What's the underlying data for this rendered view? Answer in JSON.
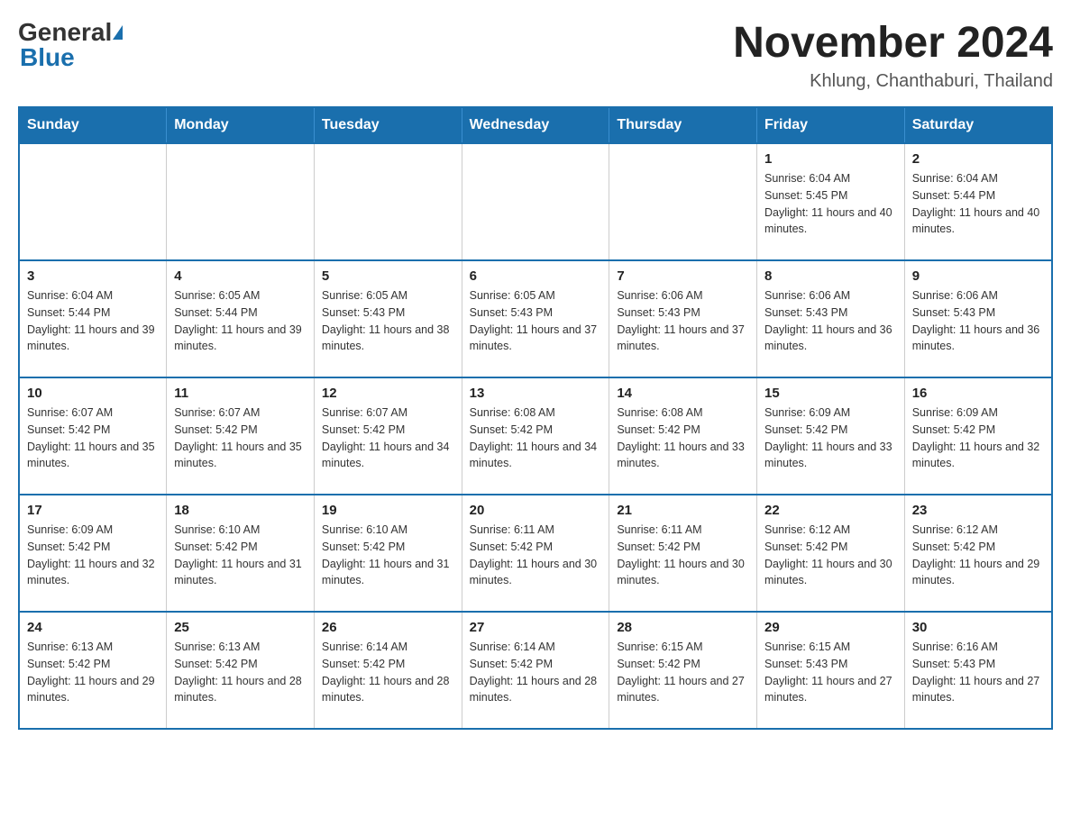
{
  "logo": {
    "general": "General",
    "blue": "Blue"
  },
  "title": "November 2024",
  "subtitle": "Khlung, Chanthaburi, Thailand",
  "weekdays": [
    "Sunday",
    "Monday",
    "Tuesday",
    "Wednesday",
    "Thursday",
    "Friday",
    "Saturday"
  ],
  "weeks": [
    [
      {
        "day": "",
        "info": ""
      },
      {
        "day": "",
        "info": ""
      },
      {
        "day": "",
        "info": ""
      },
      {
        "day": "",
        "info": ""
      },
      {
        "day": "",
        "info": ""
      },
      {
        "day": "1",
        "info": "Sunrise: 6:04 AM\nSunset: 5:45 PM\nDaylight: 11 hours and 40 minutes."
      },
      {
        "day": "2",
        "info": "Sunrise: 6:04 AM\nSunset: 5:44 PM\nDaylight: 11 hours and 40 minutes."
      }
    ],
    [
      {
        "day": "3",
        "info": "Sunrise: 6:04 AM\nSunset: 5:44 PM\nDaylight: 11 hours and 39 minutes."
      },
      {
        "day": "4",
        "info": "Sunrise: 6:05 AM\nSunset: 5:44 PM\nDaylight: 11 hours and 39 minutes."
      },
      {
        "day": "5",
        "info": "Sunrise: 6:05 AM\nSunset: 5:43 PM\nDaylight: 11 hours and 38 minutes."
      },
      {
        "day": "6",
        "info": "Sunrise: 6:05 AM\nSunset: 5:43 PM\nDaylight: 11 hours and 37 minutes."
      },
      {
        "day": "7",
        "info": "Sunrise: 6:06 AM\nSunset: 5:43 PM\nDaylight: 11 hours and 37 minutes."
      },
      {
        "day": "8",
        "info": "Sunrise: 6:06 AM\nSunset: 5:43 PM\nDaylight: 11 hours and 36 minutes."
      },
      {
        "day": "9",
        "info": "Sunrise: 6:06 AM\nSunset: 5:43 PM\nDaylight: 11 hours and 36 minutes."
      }
    ],
    [
      {
        "day": "10",
        "info": "Sunrise: 6:07 AM\nSunset: 5:42 PM\nDaylight: 11 hours and 35 minutes."
      },
      {
        "day": "11",
        "info": "Sunrise: 6:07 AM\nSunset: 5:42 PM\nDaylight: 11 hours and 35 minutes."
      },
      {
        "day": "12",
        "info": "Sunrise: 6:07 AM\nSunset: 5:42 PM\nDaylight: 11 hours and 34 minutes."
      },
      {
        "day": "13",
        "info": "Sunrise: 6:08 AM\nSunset: 5:42 PM\nDaylight: 11 hours and 34 minutes."
      },
      {
        "day": "14",
        "info": "Sunrise: 6:08 AM\nSunset: 5:42 PM\nDaylight: 11 hours and 33 minutes."
      },
      {
        "day": "15",
        "info": "Sunrise: 6:09 AM\nSunset: 5:42 PM\nDaylight: 11 hours and 33 minutes."
      },
      {
        "day": "16",
        "info": "Sunrise: 6:09 AM\nSunset: 5:42 PM\nDaylight: 11 hours and 32 minutes."
      }
    ],
    [
      {
        "day": "17",
        "info": "Sunrise: 6:09 AM\nSunset: 5:42 PM\nDaylight: 11 hours and 32 minutes."
      },
      {
        "day": "18",
        "info": "Sunrise: 6:10 AM\nSunset: 5:42 PM\nDaylight: 11 hours and 31 minutes."
      },
      {
        "day": "19",
        "info": "Sunrise: 6:10 AM\nSunset: 5:42 PM\nDaylight: 11 hours and 31 minutes."
      },
      {
        "day": "20",
        "info": "Sunrise: 6:11 AM\nSunset: 5:42 PM\nDaylight: 11 hours and 30 minutes."
      },
      {
        "day": "21",
        "info": "Sunrise: 6:11 AM\nSunset: 5:42 PM\nDaylight: 11 hours and 30 minutes."
      },
      {
        "day": "22",
        "info": "Sunrise: 6:12 AM\nSunset: 5:42 PM\nDaylight: 11 hours and 30 minutes."
      },
      {
        "day": "23",
        "info": "Sunrise: 6:12 AM\nSunset: 5:42 PM\nDaylight: 11 hours and 29 minutes."
      }
    ],
    [
      {
        "day": "24",
        "info": "Sunrise: 6:13 AM\nSunset: 5:42 PM\nDaylight: 11 hours and 29 minutes."
      },
      {
        "day": "25",
        "info": "Sunrise: 6:13 AM\nSunset: 5:42 PM\nDaylight: 11 hours and 28 minutes."
      },
      {
        "day": "26",
        "info": "Sunrise: 6:14 AM\nSunset: 5:42 PM\nDaylight: 11 hours and 28 minutes."
      },
      {
        "day": "27",
        "info": "Sunrise: 6:14 AM\nSunset: 5:42 PM\nDaylight: 11 hours and 28 minutes."
      },
      {
        "day": "28",
        "info": "Sunrise: 6:15 AM\nSunset: 5:42 PM\nDaylight: 11 hours and 27 minutes."
      },
      {
        "day": "29",
        "info": "Sunrise: 6:15 AM\nSunset: 5:43 PM\nDaylight: 11 hours and 27 minutes."
      },
      {
        "day": "30",
        "info": "Sunrise: 6:16 AM\nSunset: 5:43 PM\nDaylight: 11 hours and 27 minutes."
      }
    ]
  ]
}
